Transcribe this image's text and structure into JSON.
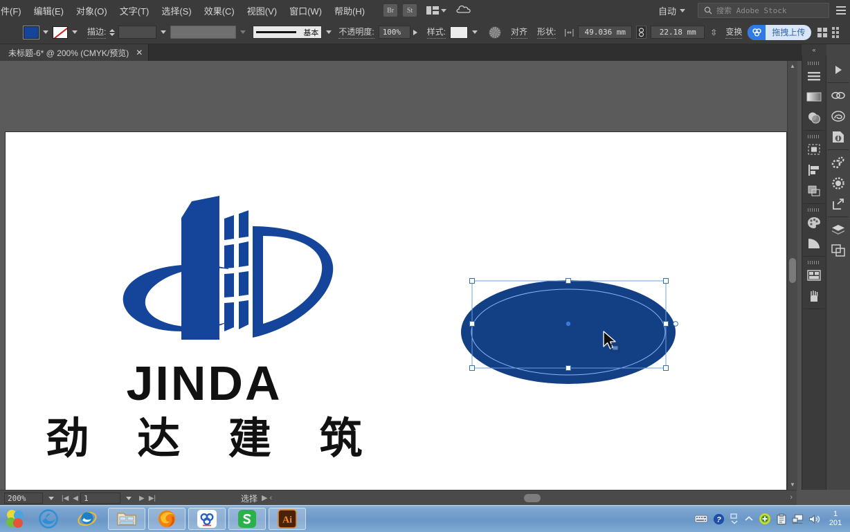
{
  "app": {
    "name": "Adobe Illustrator",
    "accent_blue": "#2f7ae5",
    "logo_blue": "#14459a",
    "shape_fill": "#134084"
  },
  "menubar": {
    "items": [
      {
        "label": "件(F)",
        "name": "menu-file"
      },
      {
        "label": "编辑(E)",
        "name": "menu-edit"
      },
      {
        "label": "对象(O)",
        "name": "menu-object"
      },
      {
        "label": "文字(T)",
        "name": "menu-type"
      },
      {
        "label": "选择(S)",
        "name": "menu-select"
      },
      {
        "label": "效果(C)",
        "name": "menu-effect"
      },
      {
        "label": "视图(V)",
        "name": "menu-view"
      },
      {
        "label": "窗口(W)",
        "name": "menu-window"
      },
      {
        "label": "帮助(H)",
        "name": "menu-help"
      }
    ],
    "bridge_badge": "Br",
    "stock_badge": "St",
    "arrange_icon": "arrange-documents-icon",
    "cloud_icon": "creative-cloud-icon",
    "workspace_label": "自动",
    "search_placeholder": "搜索 Adobe Stock",
    "menu_icon": "hamburger-menu-icon"
  },
  "options": {
    "fill_swatch_color": "#14459a",
    "stroke_swatch": "none",
    "stroke_label": "描边:",
    "stroke_weight_value": "",
    "stroke_variable_value": "",
    "profile_label": "基本",
    "opacity_label": "不透明度:",
    "opacity_value": "100%",
    "style_label": "样式:",
    "recolor_icon": "recolor-artwork-icon",
    "align_label": "对齐",
    "shape_label": "形状:",
    "width_value": "49.036 mm",
    "width_icon": "width-arrow-icon",
    "link_icon": "constrain-proportions-icon",
    "height_value": "22.18 mm",
    "height_icon": "height-arrow-icon",
    "transform_label": "变换",
    "upload_label": "拖拽上传",
    "upload_icon": "cloud-upload-icon",
    "panel_grid_icon": "panel-grid-icon",
    "more_dots_icon": "more-options-icon"
  },
  "tabs": [
    {
      "title": "未标题-6* @ 200% (CMYK/预览)",
      "close": "✕"
    }
  ],
  "artwork": {
    "logo_english": "JINDA",
    "logo_chinese": "劲 达 建 筑",
    "logo_mark_name": "jinda-jd-building-logo",
    "logo_color": "#14459a",
    "selected_shape": {
      "name": "ellipse-shape",
      "fill": "#134084",
      "selected": true,
      "handles": 8
    },
    "cursor": "selection-arrow-cursor"
  },
  "right_dock": {
    "collapse_label": "«",
    "column_a": [
      {
        "name": "properties-panel-icon",
        "label": "属性"
      },
      {
        "name": "gradient-panel-icon",
        "label": "渐变"
      },
      {
        "name": "transparency-panel-icon",
        "label": "透明度"
      },
      {
        "name": "pathfinder-panel-icon",
        "label": "路径查找器"
      },
      {
        "name": "align-panel-icon",
        "label": "对齐"
      },
      {
        "name": "transform-panel-icon",
        "label": "变换"
      },
      {
        "name": "swatches-panel-icon",
        "label": "色板"
      },
      {
        "name": "color-guide-panel-icon",
        "label": "颜色参考"
      },
      {
        "name": "artboards-panel-icon",
        "label": "画板"
      },
      {
        "name": "brushes-panel-icon",
        "label": "画笔"
      }
    ],
    "column_b": [
      {
        "name": "expand-panel-arrow-icon",
        "label": "展开"
      },
      {
        "name": "links-panel-icon",
        "label": "链接"
      },
      {
        "name": "libraries-panel-icon",
        "label": "库"
      },
      {
        "name": "document-info-panel-icon",
        "label": "文档信息"
      },
      {
        "name": "actions-panel-icon",
        "label": "动作"
      },
      {
        "name": "appearance-panel-icon",
        "label": "外观"
      },
      {
        "name": "export-panel-icon",
        "label": "导出"
      },
      {
        "name": "layers-panel-icon",
        "label": "图层"
      },
      {
        "name": "artboard-copy-panel-icon",
        "label": "画板副本"
      }
    ]
  },
  "statusbar": {
    "zoom_value": "200%",
    "page_value": "1",
    "tool_status": "选择",
    "first_page_icon": "first-page-icon",
    "prev_page_icon": "prev-page-icon",
    "next_page_icon": "next-page-icon",
    "last_page_icon": "last-page-icon"
  },
  "taskbar": {
    "start_icon": "start-orb-icon",
    "items": [
      {
        "name": "taskbar-edge-icon",
        "label": "Microsoft Edge",
        "boxed": false
      },
      {
        "name": "taskbar-ie-icon",
        "label": "Internet Explorer",
        "boxed": false
      },
      {
        "name": "taskbar-file-explorer-icon",
        "label": "文件资源管理器",
        "boxed": true
      },
      {
        "name": "taskbar-firefox-icon",
        "label": "Firefox",
        "boxed": true
      },
      {
        "name": "taskbar-baidu-netdisk-icon",
        "label": "百度网盘",
        "boxed": true
      },
      {
        "name": "taskbar-wps-icon",
        "label": "WPS",
        "boxed": true
      },
      {
        "name": "taskbar-illustrator-icon",
        "label": "Adobe Illustrator",
        "boxed": true
      }
    ],
    "tray": [
      {
        "name": "keyboard-ime-icon"
      },
      {
        "name": "help-question-icon"
      },
      {
        "name": "windows-chevron-icon"
      },
      {
        "name": "show-hidden-icons-icon"
      },
      {
        "name": "security-shield-icon"
      },
      {
        "name": "clipboard-icon"
      },
      {
        "name": "network-icon"
      },
      {
        "name": "volume-icon"
      }
    ],
    "clock_line1": "1",
    "clock_line2": "201"
  }
}
